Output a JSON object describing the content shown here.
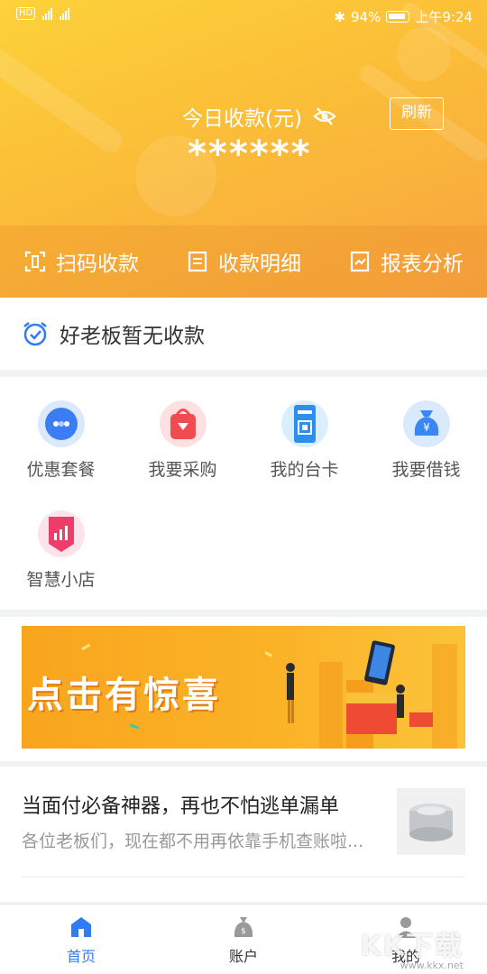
{
  "statusbar": {
    "left": "HD 2G 4G",
    "battery": "94%",
    "time": "上午9:24"
  },
  "header": {
    "balance_title": "今日收款(元)",
    "balance_value": "******",
    "refresh_label": "刷新"
  },
  "actions": [
    {
      "label": "扫码收款",
      "icon": "scan-icon"
    },
    {
      "label": "收款明细",
      "icon": "detail-icon"
    },
    {
      "label": "报表分析",
      "icon": "report-icon"
    }
  ],
  "notice": {
    "text": "好老板暂无收款"
  },
  "grid": [
    {
      "label": "优惠套餐",
      "icon": "package-icon"
    },
    {
      "label": "我要采购",
      "icon": "purchase-icon"
    },
    {
      "label": "我的台卡",
      "icon": "qr-card-icon"
    },
    {
      "label": "我要借钱",
      "icon": "loan-icon"
    },
    {
      "label": "智慧小店",
      "icon": "smart-store-icon"
    }
  ],
  "banner": {
    "text": "点击有惊喜"
  },
  "article": {
    "title": "当面付必备神器，再也不怕逃单漏单",
    "subtitle": "各位老板们，现在都不用再依靠手机查账啦..."
  },
  "tabs": [
    {
      "label": "首页",
      "icon": "home-icon",
      "active": true
    },
    {
      "label": "账户",
      "icon": "account-icon",
      "active": false
    },
    {
      "label": "我的",
      "icon": "profile-icon",
      "active": false
    }
  ],
  "watermark": {
    "text": "KK下载",
    "url": "www.kkx.net"
  },
  "colors": {
    "accent": "#2f7cf6",
    "header_start": "#fdd23a",
    "header_end": "#f7a540"
  }
}
